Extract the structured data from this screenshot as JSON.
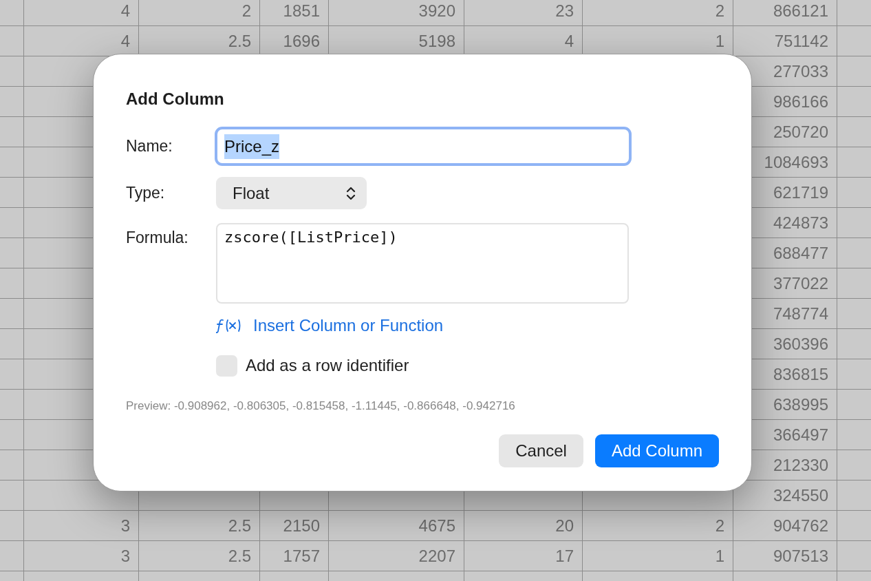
{
  "table": {
    "rows": [
      [
        "4",
        "2",
        "1851",
        "3920",
        "23",
        "2",
        "866121"
      ],
      [
        "4",
        "2.5",
        "1696",
        "5198",
        "4",
        "1",
        "751142"
      ],
      [
        "277033"
      ],
      [
        "986166"
      ],
      [
        "250720"
      ],
      [
        "1084693"
      ],
      [
        "621719"
      ],
      [
        "424873"
      ],
      [
        "688477"
      ],
      [
        "377022"
      ],
      [
        "748774"
      ],
      [
        "360396"
      ],
      [
        "836815"
      ],
      [
        "638995"
      ],
      [
        "366497"
      ],
      [
        "212330"
      ],
      [
        "324550"
      ],
      [
        "3",
        "2.5",
        "2150",
        "4675",
        "20",
        "2",
        "904762"
      ],
      [
        "3",
        "2.5",
        "1757",
        "2207",
        "17",
        "1",
        "907513"
      ]
    ]
  },
  "dialog": {
    "title": "Add Column",
    "name": {
      "label": "Name:",
      "value": "Price_z",
      "focused": true
    },
    "type": {
      "label": "Type:",
      "value": "Float"
    },
    "formula": {
      "label": "Formula:",
      "value": "zscore([ListPrice])"
    },
    "insert_link": "Insert Column or Function",
    "row_identifier": {
      "label": "Add as a row identifier",
      "checked": false
    },
    "preview": "Preview: -0.908962, -0.806305, -0.815458, -1.11445, -0.866648, -0.942716",
    "buttons": [
      {
        "label": "Cancel",
        "kind": "secondary"
      },
      {
        "label": "Add Column",
        "kind": "primary"
      }
    ]
  }
}
